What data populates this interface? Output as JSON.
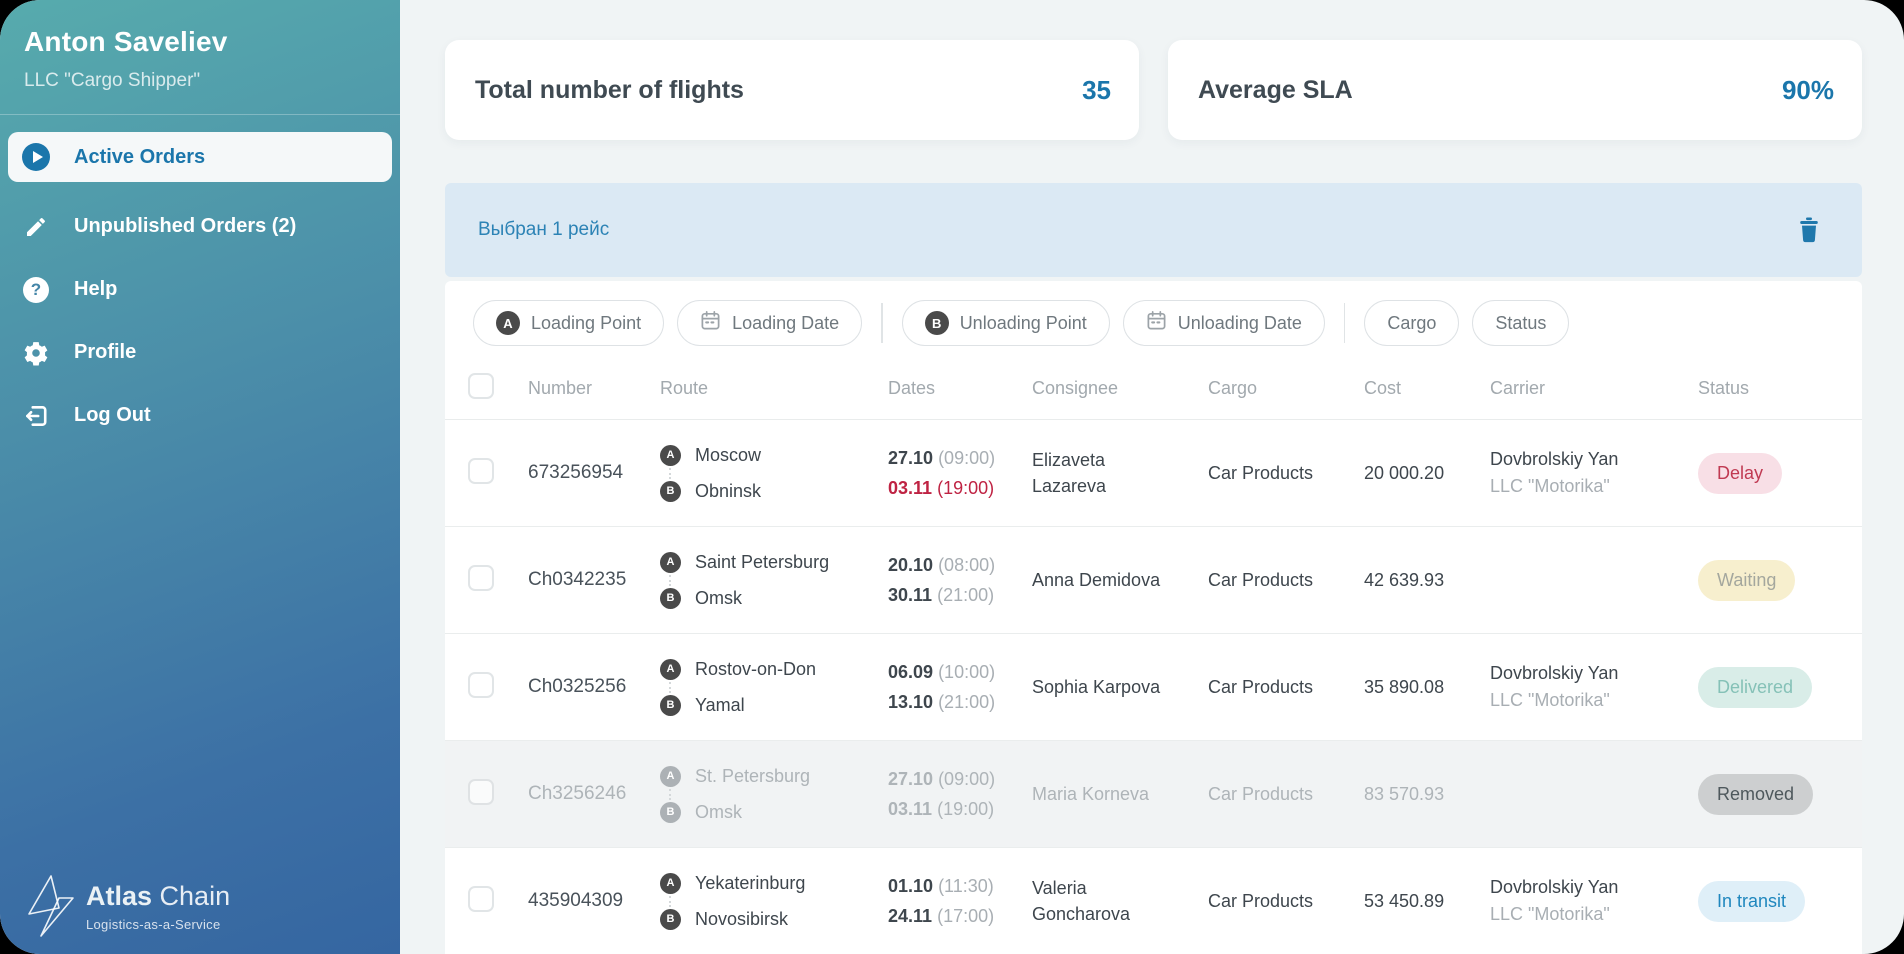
{
  "sidebar": {
    "user_name": "Anton Saveliev",
    "user_company": "LLC \"Cargo Shipper\"",
    "menu": [
      {
        "label": "Active Orders"
      },
      {
        "label": "Unpublished Orders (2)"
      },
      {
        "label": "Help"
      },
      {
        "label": "Profile"
      },
      {
        "label": "Log Out"
      }
    ],
    "logo_primary": "Atlas",
    "logo_secondary": "Chain",
    "logo_tagline": "Logistics-as-a-Service"
  },
  "stats": [
    {
      "label": "Total number of flights",
      "value": "35"
    },
    {
      "label": "Average SLA",
      "value": "90%"
    }
  ],
  "selection": {
    "label": "Выбран 1 рейс"
  },
  "filters": {
    "point_a": "A",
    "point_b": "B",
    "loading_point": "Loading Point",
    "loading_date": "Loading Date",
    "unloading_point": "Unloading Point",
    "unloading_date": "Unloading Date",
    "cargo": "Cargo",
    "status": "Status"
  },
  "table": {
    "route_a": "A",
    "route_b": "B",
    "headers": {
      "number": "Number",
      "route": "Route",
      "dates": "Dates",
      "consignee": "Consignee",
      "cargo": "Cargo",
      "cost": "Cost",
      "carrier": "Carrier",
      "status": "Status"
    },
    "rows": [
      {
        "number": "673256954",
        "from": "Moscow",
        "to": "Obninsk",
        "load_date": "27.10",
        "load_time": "(09:00)",
        "unload_date": "03.11",
        "unload_time": "(19:00)",
        "consignee": "Elizaveta Lazareva",
        "cargo": "Car Products",
        "cost": "20 000.20",
        "carrier_name": "Dovbrolskiy Yan",
        "carrier_company": "LLC \"Motorika\"",
        "status": "Delay"
      },
      {
        "number": "Ch0342235",
        "from": "Saint Petersburg",
        "to": "Omsk",
        "load_date": "20.10",
        "load_time": "(08:00)",
        "unload_date": "30.11",
        "unload_time": "(21:00)",
        "consignee": "Anna Demidova",
        "cargo": "Car Products",
        "cost": "42 639.93",
        "carrier_name": "",
        "carrier_company": "",
        "status": "Waiting"
      },
      {
        "number": "Ch0325256",
        "from": "Rostov-on-Don",
        "to": "Yamal",
        "load_date": "06.09",
        "load_time": "(10:00)",
        "unload_date": "13.10",
        "unload_time": "(21:00)",
        "consignee": "Sophia Karpova",
        "cargo": "Car Products",
        "cost": "35 890.08",
        "carrier_name": "Dovbrolskiy Yan",
        "carrier_company": "LLC \"Motorika\"",
        "status": "Delivered"
      },
      {
        "number": "Ch3256246",
        "from": "St. Petersburg",
        "to": "Omsk",
        "load_date": "27.10",
        "load_time": "(09:00)",
        "unload_date": "03.11",
        "unload_time": "(19:00)",
        "consignee": "Maria Korneva",
        "cargo": "Car Products",
        "cost": "83 570.93",
        "carrier_name": "",
        "carrier_company": "",
        "status": "Removed"
      },
      {
        "number": "435904309",
        "from": "Yekaterinburg",
        "to": "Novosibirsk",
        "load_date": "01.10",
        "load_time": "(11:30)",
        "unload_date": "24.11",
        "unload_time": "(17:00)",
        "consignee": "Valeria Goncharova",
        "cargo": "Car Products",
        "cost": "53 450.89",
        "carrier_name": "Dovbrolskiy Yan",
        "carrier_company": "LLC \"Motorika\"",
        "status": "In transit"
      }
    ]
  },
  "colors": {
    "accent_blue": "#1B76AB",
    "sidebar_teal": "#57ABAD",
    "sidebar_blue": "#3566A1",
    "selection_bg": "#DBE9F4",
    "status_delay": "#C03A52",
    "status_waiting_bg": "#F7EFCE",
    "status_delivered": "#85C1B7",
    "status_removed_bg": "#CDCFD0",
    "status_transit": "#1F87BE",
    "date_alert_red": "#BF2343"
  }
}
